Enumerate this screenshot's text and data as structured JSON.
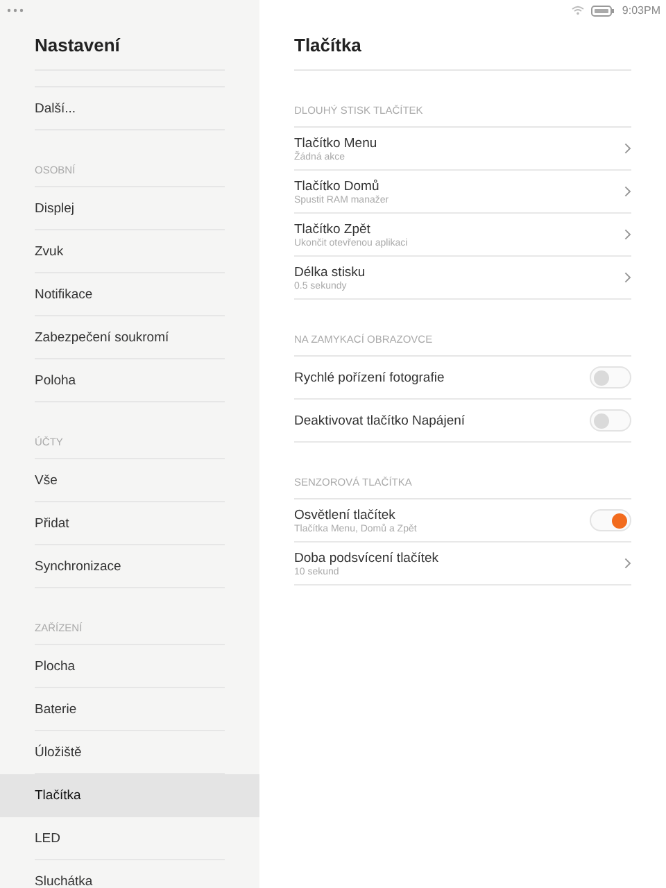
{
  "status_bar": {
    "time": "9:03PM"
  },
  "sidebar": {
    "title": "Nastavení",
    "sections": [
      {
        "items": [
          {
            "label": "Další...",
            "selected": false
          }
        ]
      },
      {
        "header": "OSOBNÍ",
        "items": [
          {
            "label": "Displej",
            "selected": false
          },
          {
            "label": "Zvuk",
            "selected": false
          },
          {
            "label": "Notifikace",
            "selected": false
          },
          {
            "label": "Zabezpečení soukromí",
            "selected": false
          },
          {
            "label": "Poloha",
            "selected": false
          }
        ]
      },
      {
        "header": "ÚČTY",
        "items": [
          {
            "label": "Vše",
            "selected": false
          },
          {
            "label": "Přidat",
            "selected": false
          },
          {
            "label": "Synchronizace",
            "selected": false
          }
        ]
      },
      {
        "header": "ZAŘÍZENÍ",
        "items": [
          {
            "label": "Plocha",
            "selected": false
          },
          {
            "label": "Baterie",
            "selected": false
          },
          {
            "label": "Úložiště",
            "selected": false
          },
          {
            "label": "Tlačítka",
            "selected": true
          },
          {
            "label": "LED",
            "selected": false
          },
          {
            "label": "Sluchátka",
            "selected": false
          }
        ]
      }
    ]
  },
  "main": {
    "title": "Tlačítka",
    "sections": [
      {
        "header": "DLOUHÝ STISK TLAČÍTEK",
        "items": [
          {
            "kind": "link",
            "label": "Tlačítko Menu",
            "summary": "Žádná akce"
          },
          {
            "kind": "link",
            "label": "Tlačítko Domů",
            "summary": "Spustit RAM manažer"
          },
          {
            "kind": "link",
            "label": "Tlačítko Zpět",
            "summary": "Ukončit otevřenou aplikaci"
          },
          {
            "kind": "link",
            "label": "Délka stisku",
            "summary": "0.5 sekundy"
          }
        ]
      },
      {
        "header": "NA ZAMYKACÍ OBRAZOVCE",
        "items": [
          {
            "kind": "toggle",
            "label": "Rychlé pořízení fotografie",
            "on": false
          },
          {
            "kind": "toggle",
            "label": "Deaktivovat tlačítko Napájení",
            "on": false
          }
        ]
      },
      {
        "header": "SENZOROVÁ TLAČÍTKA",
        "items": [
          {
            "kind": "toggle",
            "label": "Osvětlení tlačítek",
            "summary": "Tlačítka Menu, Domů a Zpět",
            "on": true
          },
          {
            "kind": "link",
            "label": "Doba podsvícení tlačítek",
            "summary": "10 sekund"
          }
        ]
      }
    ]
  }
}
